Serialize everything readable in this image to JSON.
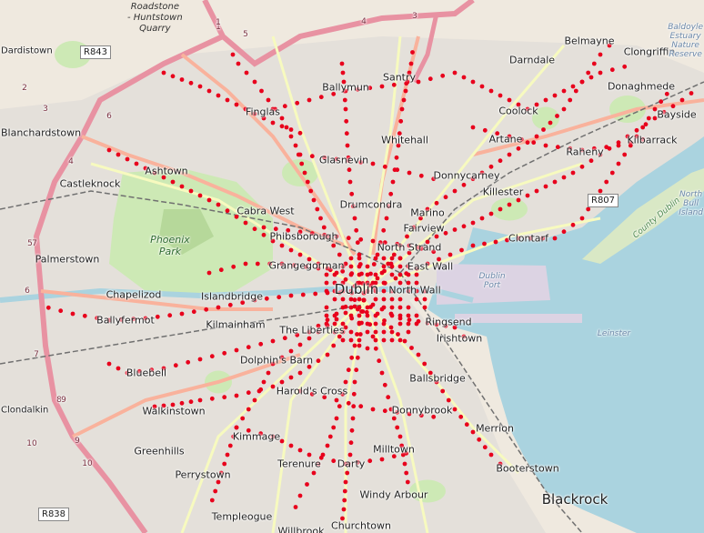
{
  "map": {
    "places": [
      {
        "name": "Ballymun"
      },
      {
        "name": "Santry"
      },
      {
        "name": "Darndale"
      },
      {
        "name": "Belmayne"
      },
      {
        "name": "Clongriffin"
      },
      {
        "name": "Donaghmede"
      },
      {
        "name": "Coolock"
      },
      {
        "name": "Bayside"
      },
      {
        "name": "Finglas"
      },
      {
        "name": "Whitehall"
      },
      {
        "name": "Artane"
      },
      {
        "name": "Kilbarrack"
      },
      {
        "name": "Raheny"
      },
      {
        "name": "Blanchardstown"
      },
      {
        "name": "Glasnevin"
      },
      {
        "name": "Ashtown"
      },
      {
        "name": "Donnycarney"
      },
      {
        "name": "Castleknock"
      },
      {
        "name": "Killester"
      },
      {
        "name": "Drumcondra"
      },
      {
        "name": "Cabra West"
      },
      {
        "name": "Marino"
      },
      {
        "name": "Fairview"
      },
      {
        "name": "Clontarf"
      },
      {
        "name": "Phibsborough"
      },
      {
        "name": "North Strand"
      },
      {
        "name": "Palmerstown"
      },
      {
        "name": "Grangegorman"
      },
      {
        "name": "East Wall"
      },
      {
        "name": "North Wall"
      },
      {
        "name": "Chapelizod"
      },
      {
        "name": "Islandbridge"
      },
      {
        "name": "Ballyfermot"
      },
      {
        "name": "Kilmainham"
      },
      {
        "name": "Ringsend"
      },
      {
        "name": "The Liberties"
      },
      {
        "name": "Irishtown"
      },
      {
        "name": "Dolphin's Barn"
      },
      {
        "name": "Bluebell"
      },
      {
        "name": "Ballsbridge"
      },
      {
        "name": "Harold's Cross"
      },
      {
        "name": "Walkinstown"
      },
      {
        "name": "Donnybrook"
      },
      {
        "name": "Merrion"
      },
      {
        "name": "Kimmage"
      },
      {
        "name": "Greenhills"
      },
      {
        "name": "Milltown"
      },
      {
        "name": "Terenure"
      },
      {
        "name": "Darty"
      },
      {
        "name": "Booterstown"
      },
      {
        "name": "Perrystown"
      },
      {
        "name": "Windy Arbour"
      },
      {
        "name": "Blackrock"
      },
      {
        "name": "Templeogue"
      },
      {
        "name": "Churchtown"
      },
      {
        "name": "Willbrook"
      },
      {
        "name": "Clondalkin"
      },
      {
        "name": "Dardistown"
      }
    ],
    "city_label": "Dublin",
    "parks": [
      {
        "name": "Phoenix\nPark"
      }
    ],
    "water": [
      {
        "name": "Dublin\nPort"
      },
      {
        "name": "Leinster"
      },
      {
        "name": "County Dublin"
      },
      {
        "name": "North\nBull\nIsland"
      },
      {
        "name": "Baldoyle\nEstuary\nNature\nReserve"
      }
    ],
    "quarry": "Roadstone\n- Huntstown\nQuarry",
    "road_shields": [
      "R843",
      "R807",
      "R838"
    ],
    "junction_numbers": [
      "1",
      "2",
      "3",
      "4",
      "5",
      "6",
      "7",
      "8",
      "9",
      "10",
      "1",
      "3",
      "4",
      "5",
      "6",
      "7",
      "9",
      "10"
    ],
    "colors": {
      "land": "#efe9df",
      "residential": "#e0dcd7",
      "park": "#cde9b5",
      "parkDark": "#b6d89a",
      "water": "#aad3df",
      "motorway": "#e892a2",
      "trunk": "#f9b29c",
      "primary": "#fcd6a4",
      "secondary": "#f7fabf",
      "rail": "#707070",
      "stop": "#e8001c",
      "sandbank": "#d9e8c5"
    }
  }
}
